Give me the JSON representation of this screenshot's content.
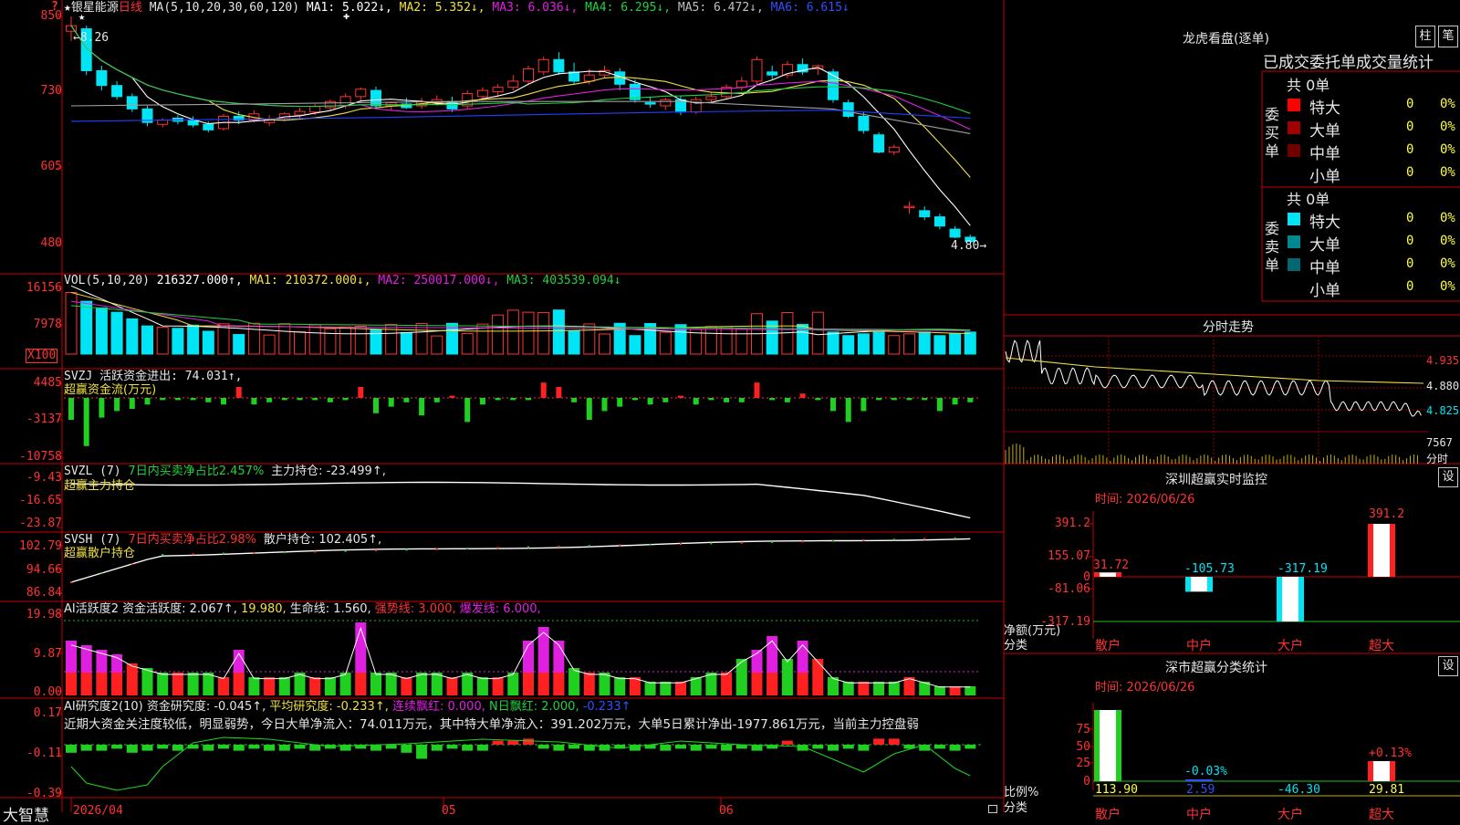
{
  "colors": {
    "up": "#ff3232",
    "down": "#00e5f5",
    "grid": "#b00000",
    "ma1": "#ffffff",
    "ma2": "#f0e040",
    "ma3": "#e020e0",
    "ma4": "#20d040",
    "ma5": "#a0a0a0",
    "ma6": "#2040ff"
  },
  "main_chart": {
    "star_icon": "★",
    "stock_name": "银星能源",
    "period": "日线",
    "ma_header": "MA(5,10,20,30,60,120)",
    "ma_items": [
      {
        "text": "MA1: 5.022↓,",
        "color": "#ffffff"
      },
      {
        "text": "MA2: 5.352↓,",
        "color": "#f0e040"
      },
      {
        "text": "MA3: 6.036↓,",
        "color": "#e020e0"
      },
      {
        "text": "MA4: 6.295↓,",
        "color": "#20d040"
      },
      {
        "text": "MA5: 6.472↓,",
        "color": "#c0c0c0"
      },
      {
        "text": "MA6: 6.615↓",
        "color": "#3050ff"
      }
    ],
    "y_ticks": [
      "850",
      "730",
      "605",
      "480"
    ],
    "high_label": "8.26",
    "low_label": "4.80"
  },
  "vol_panel": {
    "header_name": "VOL(5,10,20)",
    "items": [
      {
        "text": "216327.000↑,",
        "color": "#ffffff"
      },
      {
        "text": "MA1: 210372.000↓,",
        "color": "#f0e040"
      },
      {
        "text": "MA2: 250017.000↓,",
        "color": "#e020e0"
      },
      {
        "text": "MA3: 403539.094↓",
        "color": "#20d040"
      }
    ],
    "y_ticks": [
      "16156",
      "7978"
    ],
    "unit": "X100"
  },
  "svzj_panel": {
    "line1": "SVZJ  活跃资金进出: 74.031↑,",
    "line2": "超赢资金流(万元)",
    "y_ticks": [
      "4485",
      "-3137",
      "-10758"
    ]
  },
  "svzl_panel": {
    "name": "SVZL (7)",
    "ratio": "7日内买卖净占比2.457%",
    "value": "主力持仓: -23.499↑,",
    "line2": "超赢主力持仓",
    "y_ticks": [
      "-9.43",
      "-16.65",
      "-23.87"
    ]
  },
  "svsh_panel": {
    "name": "SVSH (7)",
    "ratio": "7日内买卖净占比2.98%",
    "value": "散户持仓: 102.405↑,",
    "line2": "超赢散户持仓",
    "y_ticks": [
      "102.79",
      "94.66",
      "86.84"
    ]
  },
  "ai2_panel": {
    "items": [
      {
        "text": "AI活跃度2 资金活跃度: 2.067↑,",
        "color": "#e6e6e6"
      },
      {
        "text": "19.980,",
        "color": "#f0e040"
      },
      {
        "text": "生命线: 1.560,",
        "color": "#e6e6e6"
      },
      {
        "text": "强势线: 3.000,",
        "color": "#ff3232"
      },
      {
        "text": "爆发线: 6.000,",
        "color": "#e020e0"
      }
    ],
    "y_ticks": [
      "19.98",
      "9.87",
      "0.00"
    ]
  },
  "ai_research_panel": {
    "items": [
      {
        "text": "AI研究度2(10) 资金研究度: -0.045↑,",
        "color": "#e6e6e6"
      },
      {
        "text": "平均研究度: -0.233↑,",
        "color": "#f0e040"
      },
      {
        "text": "连续飘红: 0.000,",
        "color": "#e020e0"
      },
      {
        "text": "N日飘红: 2.000,",
        "color": "#20d040"
      },
      {
        "text": "-0.233↑",
        "color": "#3050ff"
      }
    ],
    "summary": "近期大资金关注度较低，明显弱势，今日大单净流入：74.011万元，其中特大单净流入：391.202万元，大单5日累计净出-1977.861万元，当前主力控盘弱",
    "y_ticks": [
      "0.17",
      "-0.11",
      "-0.39"
    ]
  },
  "bottom_bar": {
    "brand": "大智慧",
    "date_start": "2026/04",
    "month_labels": [
      "05",
      "06"
    ]
  },
  "right_panel": {
    "title": "龙虎看盘(逐单)",
    "tab_buttons": [
      "柱",
      "笔"
    ],
    "sub_tabs": [
      "已成交",
      "委托单",
      "成交量",
      "统计"
    ],
    "buy": {
      "side_label": "委买单",
      "total": "共 0单",
      "rows": [
        {
          "name": "特大",
          "value": "0",
          "pct": "0%",
          "color": "#ff0000"
        },
        {
          "name": "大单",
          "value": "0",
          "pct": "0%",
          "color": "#a00000"
        },
        {
          "name": "中单",
          "value": "0",
          "pct": "0%",
          "color": "#700000"
        },
        {
          "name": "小单",
          "value": "0",
          "pct": "0%",
          "color": ""
        }
      ]
    },
    "sell": {
      "side_label": "委卖单",
      "total": "共 0单",
      "rows": [
        {
          "name": "特大",
          "value": "0",
          "pct": "0%",
          "color": "#00e5f5"
        },
        {
          "name": "大单",
          "value": "0",
          "pct": "0%",
          "color": "#008890"
        },
        {
          "name": "中单",
          "value": "0",
          "pct": "0%",
          "color": "#006870"
        },
        {
          "name": "小单",
          "value": "0",
          "pct": "0%",
          "color": ""
        }
      ]
    },
    "intraday": {
      "title": "分时走势",
      "price_ticks": [
        "4.935",
        "4.880",
        "4.825"
      ],
      "vol_tick": "7567",
      "vol_label": "分时"
    },
    "realtime": {
      "title": "深圳超赢实时监控",
      "settings": "设",
      "date": "时间: 2026/06/26",
      "y_ticks": [
        "391.2",
        "155.07",
        "0",
        "-81.06",
        "-317.19"
      ],
      "axis_label_1": "净额(万元)",
      "axis_label_2": "分类",
      "categories": [
        "散户",
        "中户",
        "大户",
        "超大"
      ],
      "values": [
        31.72,
        -105.73,
        -317.19,
        391.2
      ],
      "value_labels": [
        "31.72",
        "-105.73",
        "-317.19",
        "391.2"
      ]
    },
    "classify": {
      "title": "深市超赢分类统计",
      "settings": "设",
      "date": "时间: 2026/06/26",
      "y_ticks": [
        "75",
        "50",
        "25",
        "0"
      ],
      "axis_label_1": "比例%",
      "axis_label_2": "分类",
      "categories": [
        "散户",
        "中户",
        "大户",
        "超大"
      ],
      "pct_labels": [
        "",
        "-0.03%",
        "",
        "+0.13%"
      ],
      "values": [
        "113.90",
        "2.59",
        "-46.30",
        "29.81"
      ]
    }
  }
}
